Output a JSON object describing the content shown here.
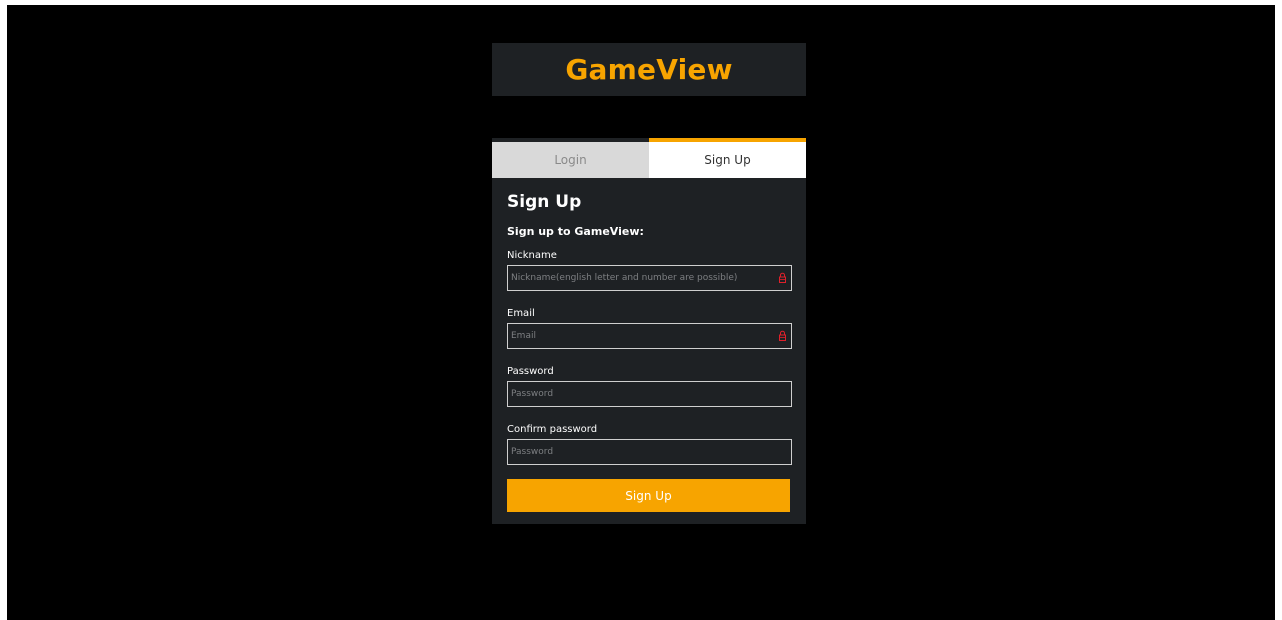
{
  "app": {
    "title": "GameView"
  },
  "tabs": {
    "login_label": "Login",
    "signup_label": "Sign Up",
    "active": "Sign Up"
  },
  "form": {
    "title": "Sign Up",
    "subtitle": "Sign up to GameView:",
    "nickname": {
      "label": "Nickname",
      "placeholder": "Nickname(english letter and number are possible)",
      "value": ""
    },
    "email": {
      "label": "Email",
      "placeholder": "Email",
      "value": ""
    },
    "password": {
      "label": "Password",
      "placeholder": "Password",
      "value": ""
    },
    "confirm_password": {
      "label": "Confirm password",
      "placeholder": "Password",
      "value": ""
    },
    "submit_label": "Sign Up"
  },
  "icons": {
    "required_field": "lock-icon"
  },
  "colors": {
    "accent": "#f7a400",
    "background": "#000000",
    "panel": "#1e2124",
    "tab_inactive": "#d9d9d9",
    "required_icon": "#e0202a"
  }
}
